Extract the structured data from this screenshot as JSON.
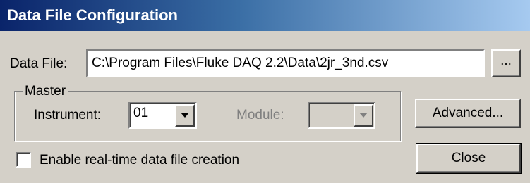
{
  "window": {
    "title": "Data File Configuration"
  },
  "data_file": {
    "label": "Data File:",
    "value": "C:\\Program Files\\Fluke DAQ 2.2\\Data\\2jr_3nd.csv",
    "browse_label": "..."
  },
  "master": {
    "group_label": "Master",
    "instrument_label": "Instrument:",
    "instrument_value": "01",
    "module_label": "Module:",
    "module_value": ""
  },
  "buttons": {
    "advanced_label": "Advanced...",
    "close_label": "Close"
  },
  "realtime": {
    "label": "Enable real-time data file creation",
    "checked": false
  },
  "icons": {
    "dropdown": "chevron-down-icon"
  }
}
